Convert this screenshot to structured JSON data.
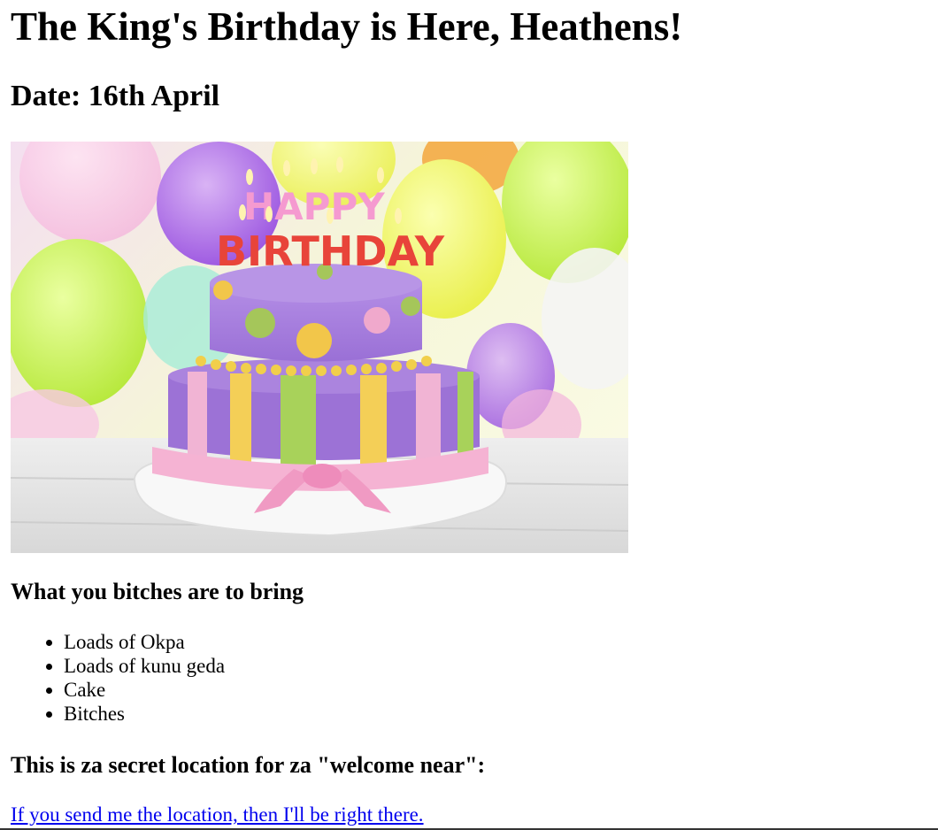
{
  "header": {
    "title": "The King's Birthday is Here, Heathens!",
    "date": "Date: 16th April"
  },
  "hero_image": {
    "cake_text_line1": "HAPPY",
    "cake_text_line2": "BIRTHDAY"
  },
  "bring_section": {
    "heading": "What you bitches are to bring",
    "items": [
      "Loads of Okpa",
      "Loads of kunu geda",
      "Cake",
      "Bitches"
    ]
  },
  "location_section": {
    "heading": "This is za secret location for za \"welcome near\":",
    "link_text": "If you send me the location, then I'll be right there."
  },
  "colors": {
    "link": "#0000ee",
    "text": "#000000",
    "background": "#ffffff"
  }
}
